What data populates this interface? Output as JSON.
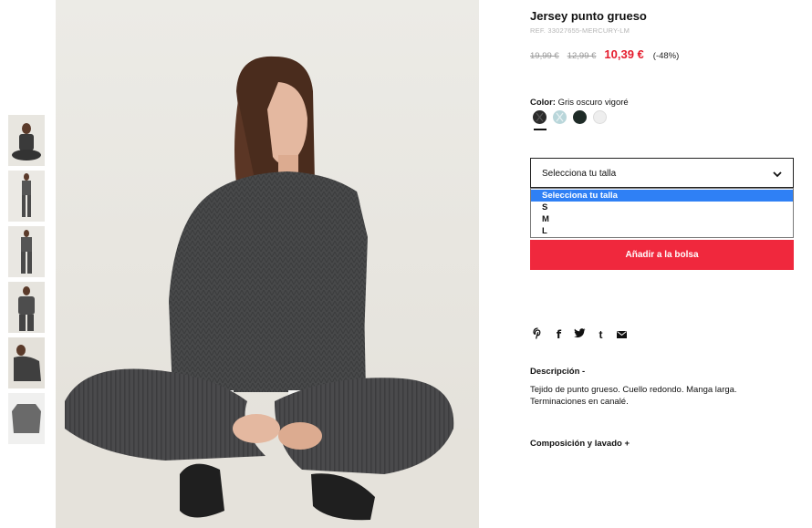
{
  "product": {
    "title": "Jersey punto grueso",
    "ref": "REF. 33027655-MERCURY-LM",
    "price_original_1": "19,99 €",
    "price_original_2": "12,99 €",
    "price_current": "10,39 €",
    "discount": "(-48%)",
    "color_label": "Color:",
    "color_value": "Gris oscuro vigoré",
    "swatches": [
      {
        "name": "gris-oscuro",
        "color": "#2b2b2b"
      },
      {
        "name": "azul-claro",
        "color": "#b9d6da"
      },
      {
        "name": "verde-oscuro",
        "color": "#1e2b27"
      },
      {
        "name": "blanco",
        "color": "#eeeeee"
      }
    ]
  },
  "size_select": {
    "placeholder": "Selecciona tu talla",
    "options": [
      "Selecciona tu talla",
      "S",
      "M",
      "L"
    ]
  },
  "add_to_bag_label": "Añadir a la bolsa",
  "share": {
    "icons": [
      "pinterest-icon",
      "facebook-icon",
      "twitter-icon",
      "tumblr-icon",
      "mail-icon"
    ],
    "glyphs": [
      "℗",
      "f",
      "t",
      "t",
      "✉"
    ]
  },
  "description": {
    "title": "Descripción -",
    "text": "Tejido de punto grueso. Cuello redondo. Manga larga. Terminaciones en canalé."
  },
  "composition_title": "Composición y lavado +",
  "colors": {
    "accent": "#f0283d",
    "price": "#e51d2e",
    "select_highlight": "#2f80f5"
  }
}
